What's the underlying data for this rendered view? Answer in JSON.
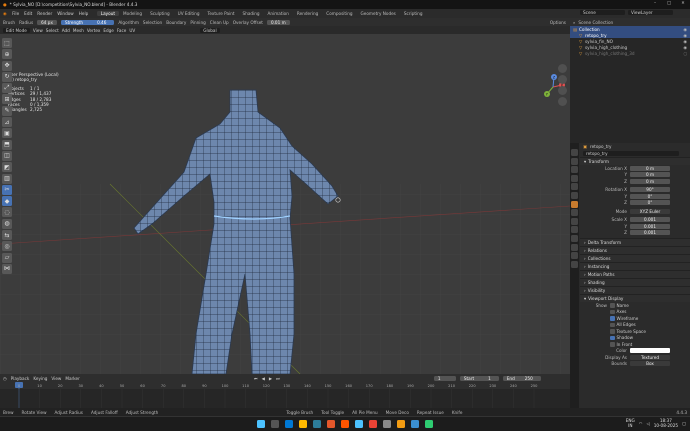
{
  "window": {
    "title": "* Sylvia_NO [D:\\competition\\Sylvia_NO.blend] - Blender 4.4.3",
    "minimize": "–",
    "maximize": "□",
    "close": "✕"
  },
  "menu": [
    "File",
    "Edit",
    "Render",
    "Window",
    "Help"
  ],
  "workspaces": [
    "Layout",
    "Modeling",
    "Sculpting",
    "UV Editing",
    "Texture Paint",
    "Shading",
    "Animation",
    "Rendering",
    "Compositing",
    "Geometry Nodes",
    "Scripting"
  ],
  "active_workspace": "Layout",
  "scene": {
    "label": "Scene",
    "view_layer": "ViewLayer"
  },
  "toolheader": {
    "brush": "Brush",
    "radius_label": "Radius",
    "radius_value": "64 px",
    "strength_label": "Strength",
    "strength_value": "0.46",
    "algorithm": "Algorithm",
    "selection": "Selection",
    "boundary": "Boundary",
    "pinning": "Pinning",
    "cleanup": "Clean Up",
    "overlay_offset_label": "Overlay Offset",
    "overlay_offset_value": "0.01 m",
    "options": "Options"
  },
  "viewheader": {
    "mode": "Edit Mode",
    "items": [
      "View",
      "Select",
      "Add",
      "Mesh",
      "Vertex",
      "Edge",
      "Face",
      "UV"
    ],
    "transform": "Global"
  },
  "viewport": {
    "view_name": "User Perspective (Local)",
    "object": "(1) retopo_try",
    "stats": [
      {
        "label": "Objects",
        "value": "1 / 1"
      },
      {
        "label": "Vertices",
        "value": "29 / 1,437"
      },
      {
        "label": "Edges",
        "value": "18 / 2,783"
      },
      {
        "label": "Faces",
        "value": "0 / 1,359"
      },
      {
        "label": "Triangles",
        "value": "2,725"
      }
    ],
    "gizmo": {
      "x": "X",
      "y": "Y",
      "z": "Z"
    }
  },
  "outliner": {
    "header": "Scene Collection",
    "rows": [
      {
        "name": "Collection",
        "selected": true,
        "indent": 0
      },
      {
        "name": "retopo_try",
        "selected": true,
        "indent": 1
      },
      {
        "name": "sylvia_fin_NO",
        "selected": false,
        "indent": 1
      },
      {
        "name": "sylvia_high_clothing",
        "selected": false,
        "indent": 1
      },
      {
        "name": "sylvia_high_clothing_3d",
        "selected": false,
        "indent": 1,
        "dim": true
      }
    ]
  },
  "properties": {
    "object_name": "retopo_try",
    "object_field": "retopo_try",
    "transform_title": "Transform",
    "location": [
      {
        "k": "Location X",
        "v": "0 m"
      },
      {
        "k": "Y",
        "v": "0 m"
      },
      {
        "k": "Z",
        "v": "0 m"
      }
    ],
    "rotation": [
      {
        "k": "Rotation X",
        "v": "90°"
      },
      {
        "k": "Y",
        "v": "0°"
      },
      {
        "k": "Z",
        "v": "0°"
      }
    ],
    "mode": {
      "k": "Mode",
      "v": "XYZ Euler"
    },
    "scale": [
      {
        "k": "Scale X",
        "v": "0.001"
      },
      {
        "k": "Y",
        "v": "0.001"
      },
      {
        "k": "Z",
        "v": "0.001"
      }
    ],
    "sections": [
      "Delta Transform",
      "Relations",
      "Collections",
      "Instancing",
      "Motion Paths",
      "Shading",
      "Visibility"
    ],
    "viewport_display": "Viewport Display",
    "show_label": "Show",
    "checks": [
      {
        "name": "Name",
        "on": false
      },
      {
        "name": "Axes",
        "on": false
      },
      {
        "name": "Wireframe",
        "on": true
      },
      {
        "name": "All Edges",
        "on": false
      },
      {
        "name": "Texture Space",
        "on": false
      },
      {
        "name": "Shadow",
        "on": true
      },
      {
        "name": "In Front",
        "on": false
      }
    ],
    "color_label": "Color",
    "display_as_label": "Display As",
    "display_as_value": "Textured",
    "bounds_label": "Bounds",
    "bounds_value": "Box"
  },
  "timeline": {
    "items": [
      "Playback",
      "Keying",
      "View",
      "Marker"
    ],
    "current_frame": "1",
    "start_label": "Start",
    "start": "1",
    "end_label": "End",
    "end": "250",
    "ticks": [
      "0",
      "10",
      "20",
      "30",
      "40",
      "50",
      "60",
      "70",
      "80",
      "90",
      "100",
      "110",
      "120",
      "130",
      "140",
      "150",
      "160",
      "170",
      "180",
      "190",
      "200",
      "210",
      "220",
      "230",
      "240",
      "250"
    ]
  },
  "statusbar": [
    "Rotate View",
    "Adjust Radius",
    "Adjust Falloff",
    "Adjust Strength",
    "Toggle Brush",
    "Tool Toggle",
    "All Pie Menu",
    "Move Deco",
    "Repeat Issue",
    "Knife"
  ],
  "statusbar_left": "Brew",
  "version": "4.4.3",
  "taskbar": {
    "icons": [
      "#0078d4",
      "#ffb900",
      "#2d7d9a",
      "#e3572b",
      "#ff5500",
      "#4cc2ff",
      "#ea4335",
      "#8a8a8a",
      "#f39c12",
      "#3b8fd1",
      "#2ecc71"
    ],
    "lang": "ENG",
    "region": "IN",
    "time": "18:37",
    "date": "10-08-2025"
  }
}
